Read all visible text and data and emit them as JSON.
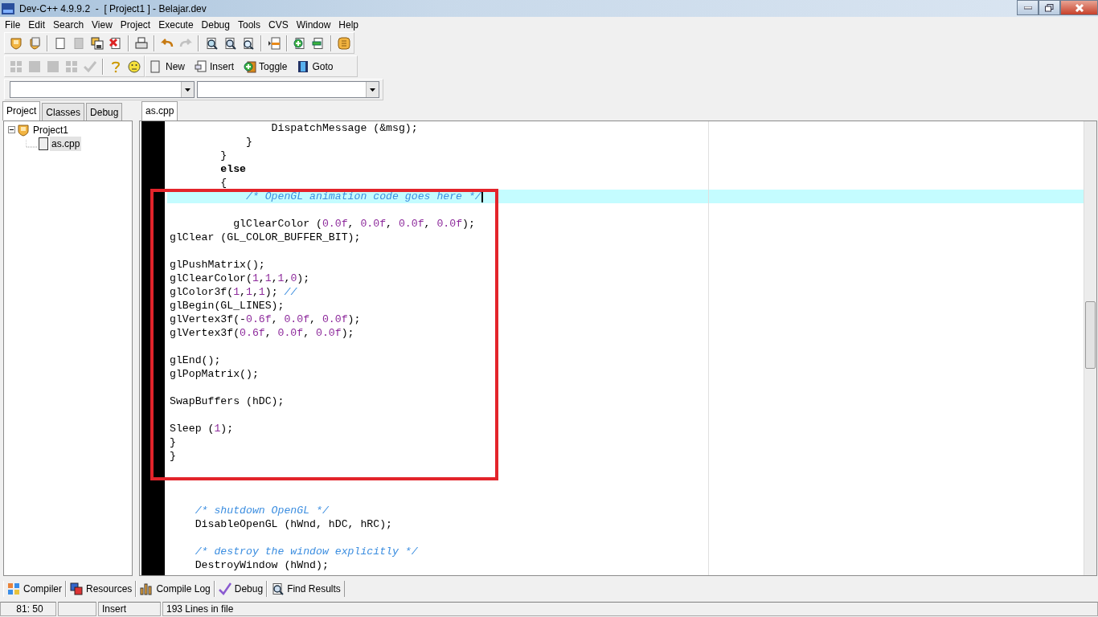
{
  "window": {
    "title": "Dev-C++ 4.9.9.2  -  [ Project1 ] - Belajar.dev"
  },
  "menu": [
    "File",
    "Edit",
    "Search",
    "View",
    "Project",
    "Execute",
    "Debug",
    "Tools",
    "CVS",
    "Window",
    "Help"
  ],
  "toolbar_main": [
    {
      "disabled": false
    },
    {
      "disabled": false
    },
    {
      "disabled": false
    },
    {
      "disabled": true
    },
    {
      "disabled": false
    },
    {
      "disabled": false
    },
    {
      "disabled": false
    },
    {
      "disabled": false
    },
    {
      "disabled": true
    },
    {
      "disabled": false
    },
    {
      "disabled": false
    },
    {
      "disabled": false
    },
    {
      "disabled": false
    },
    {
      "disabled": false
    },
    {
      "disabled": false
    },
    {
      "disabled": false
    }
  ],
  "toolbar_debug": [
    {
      "disabled": true
    },
    {
      "disabled": true
    },
    {
      "disabled": true
    },
    {
      "disabled": true
    },
    {
      "disabled": true
    },
    {
      "disabled": false
    },
    {
      "disabled": false
    }
  ],
  "bookmark_buttons": [
    {
      "label": "New"
    },
    {
      "label": "Insert"
    },
    {
      "label": "Toggle"
    },
    {
      "label": "Goto"
    }
  ],
  "side_tabs": [
    {
      "label": "Project",
      "selected": true
    },
    {
      "label": "Classes",
      "selected": false
    },
    {
      "label": "Debug",
      "selected": false
    }
  ],
  "tree": [
    {
      "label": "Project1",
      "expanded": true,
      "selected": false,
      "children": [
        {
          "label": "as.cpp",
          "selected": true
        }
      ]
    }
  ],
  "editor_tabs": [
    {
      "label": "as.cpp",
      "selected": true
    }
  ],
  "code_lines": [
    {
      "current": false,
      "segments": [
        {
          "kind": "code",
          "text": "                DispatchMessage (&msg);"
        }
      ]
    },
    {
      "current": false,
      "segments": [
        {
          "kind": "code",
          "text": "            }"
        }
      ]
    },
    {
      "current": false,
      "segments": [
        {
          "kind": "code",
          "text": "        }"
        }
      ]
    },
    {
      "current": false,
      "segments": [
        {
          "kind": "keyword",
          "text": "        else"
        }
      ]
    },
    {
      "current": false,
      "segments": [
        {
          "kind": "code",
          "text": "        {"
        }
      ]
    },
    {
      "current": true,
      "segments": [
        {
          "kind": "comment",
          "text": "            /* OpenGL animation code goes here */"
        }
      ]
    },
    {
      "current": false
    },
    {
      "current": false,
      "segments": [
        {
          "kind": "code",
          "text": "          glClearColor ("
        },
        {
          "kind": "number",
          "text": "0.0f"
        },
        {
          "kind": "code",
          "text": ", "
        },
        {
          "kind": "number",
          "text": "0.0f"
        },
        {
          "kind": "code",
          "text": ", "
        },
        {
          "kind": "number",
          "text": "0.0f"
        },
        {
          "kind": "code",
          "text": ", "
        },
        {
          "kind": "number",
          "text": "0.0f"
        },
        {
          "kind": "code",
          "text": ");"
        }
      ]
    },
    {
      "current": false,
      "segments": [
        {
          "kind": "code",
          "text": "glClear (GL_COLOR_BUFFER_BIT);"
        }
      ]
    },
    {
      "current": false
    },
    {
      "current": false,
      "segments": [
        {
          "kind": "code",
          "text": "glPushMatrix();"
        }
      ]
    },
    {
      "current": false,
      "segments": [
        {
          "kind": "code",
          "text": "glClearColor("
        },
        {
          "kind": "number",
          "text": "1"
        },
        {
          "kind": "code",
          "text": ","
        },
        {
          "kind": "number",
          "text": "1"
        },
        {
          "kind": "code",
          "text": ","
        },
        {
          "kind": "number",
          "text": "1"
        },
        {
          "kind": "code",
          "text": ","
        },
        {
          "kind": "number",
          "text": "0"
        },
        {
          "kind": "code",
          "text": ");"
        }
      ]
    },
    {
      "current": false,
      "segments": [
        {
          "kind": "code",
          "text": "glColor3f("
        },
        {
          "kind": "number",
          "text": "1"
        },
        {
          "kind": "code",
          "text": ","
        },
        {
          "kind": "number",
          "text": "1"
        },
        {
          "kind": "code",
          "text": ","
        },
        {
          "kind": "number",
          "text": "1"
        },
        {
          "kind": "code",
          "text": "); "
        },
        {
          "kind": "comment",
          "text": "//"
        }
      ]
    },
    {
      "current": false,
      "segments": [
        {
          "kind": "code",
          "text": "glBegin(GL_LINES);"
        }
      ]
    },
    {
      "current": false,
      "segments": [
        {
          "kind": "code",
          "text": "glVertex3f(-"
        },
        {
          "kind": "number",
          "text": "0.6f"
        },
        {
          "kind": "code",
          "text": ", "
        },
        {
          "kind": "number",
          "text": "0.0f"
        },
        {
          "kind": "code",
          "text": ", "
        },
        {
          "kind": "number",
          "text": "0.0f"
        },
        {
          "kind": "code",
          "text": ");"
        }
      ]
    },
    {
      "current": false,
      "segments": [
        {
          "kind": "code",
          "text": "glVertex3f("
        },
        {
          "kind": "number",
          "text": "0.6f"
        },
        {
          "kind": "code",
          "text": ", "
        },
        {
          "kind": "number",
          "text": "0.0f"
        },
        {
          "kind": "code",
          "text": ", "
        },
        {
          "kind": "number",
          "text": "0.0f"
        },
        {
          "kind": "code",
          "text": ");"
        }
      ]
    },
    {
      "current": false
    },
    {
      "current": false,
      "segments": [
        {
          "kind": "code",
          "text": "glEnd();"
        }
      ]
    },
    {
      "current": false,
      "segments": [
        {
          "kind": "code",
          "text": "glPopMatrix();"
        }
      ]
    },
    {
      "current": false
    },
    {
      "current": false,
      "segments": [
        {
          "kind": "code",
          "text": "SwapBuffers (hDC);"
        }
      ]
    },
    {
      "current": false
    },
    {
      "current": false,
      "segments": [
        {
          "kind": "code",
          "text": "Sleep ("
        },
        {
          "kind": "number",
          "text": "1"
        },
        {
          "kind": "code",
          "text": ");"
        }
      ]
    },
    {
      "current": false,
      "segments": [
        {
          "kind": "code",
          "text": "}"
        }
      ]
    },
    {
      "current": false,
      "segments": [
        {
          "kind": "code",
          "text": "}"
        }
      ]
    },
    {
      "current": false
    },
    {
      "current": false
    },
    {
      "current": false
    },
    {
      "current": false,
      "segments": [
        {
          "kind": "comment",
          "text": "    /* shutdown OpenGL */"
        }
      ]
    },
    {
      "current": false,
      "segments": [
        {
          "kind": "code",
          "text": "    DisableOpenGL (hWnd, hDC, hRC);"
        }
      ]
    },
    {
      "current": false
    },
    {
      "current": false,
      "segments": [
        {
          "kind": "comment",
          "text": "    /* destroy the window explicitly */"
        }
      ]
    },
    {
      "current": false,
      "segments": [
        {
          "kind": "code",
          "text": "    DestroyWindow (hWnd);"
        }
      ]
    }
  ],
  "bottom_tabs": [
    {
      "label": "Compiler"
    },
    {
      "label": "Resources"
    },
    {
      "label": "Compile Log"
    },
    {
      "label": "Debug"
    },
    {
      "label": "Find Results"
    }
  ],
  "status_bar": {
    "position": "81: 50",
    "mode": "Insert",
    "lines": "193 Lines in file"
  }
}
